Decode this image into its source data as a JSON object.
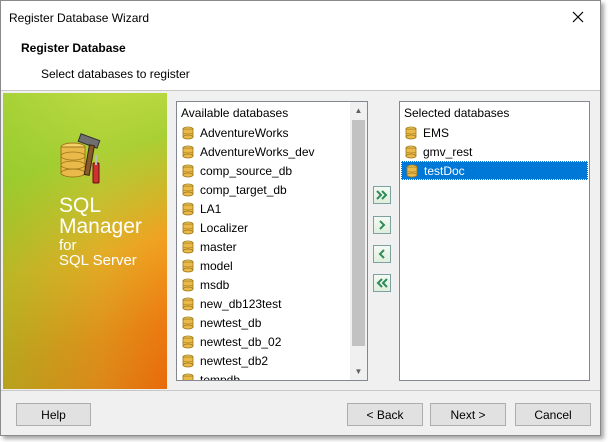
{
  "window": {
    "title": "Register Database Wizard"
  },
  "header": {
    "title": "Register Database",
    "subtitle": "Select databases to register"
  },
  "banner": {
    "line1": "SQL",
    "line2": "Manager",
    "line3": "for",
    "line4": "SQL Server"
  },
  "available": {
    "header": "Available databases",
    "items": [
      "AdventureWorks",
      "AdventureWorks_dev",
      "comp_source_db",
      "comp_target_db",
      "LA1",
      "Localizer",
      "master",
      "model",
      "msdb",
      "new_db123test",
      "newtest_db",
      "newtest_db_02",
      "newtest_db2",
      "tempdb"
    ]
  },
  "selected": {
    "header": "Selected databases",
    "items": [
      "EMS",
      "gmv_rest",
      "testDoc"
    ],
    "selected_item": "testDoc"
  },
  "buttons": {
    "help": "Help",
    "back": "< Back",
    "next": "Next >",
    "cancel": "Cancel"
  },
  "icons": {
    "add_all": "double-chevron-right-icon",
    "add": "chevron-right-icon",
    "remove": "chevron-left-icon",
    "remove_all": "double-chevron-left-icon",
    "db": "database-icon"
  },
  "colors": {
    "selection": "#0078d7",
    "arrow": "#2e8b57",
    "db_icon": "#e9b94a"
  }
}
